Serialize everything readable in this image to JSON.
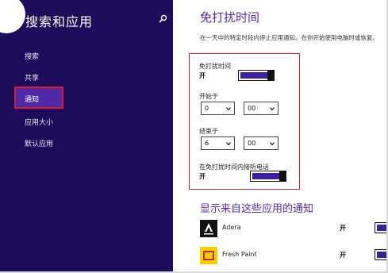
{
  "sidebar": {
    "title": "搜索和应用",
    "items": [
      {
        "label": "搜索"
      },
      {
        "label": "共享"
      },
      {
        "label": "通知",
        "active": true
      },
      {
        "label": "应用大小"
      },
      {
        "label": "默认应用"
      }
    ]
  },
  "quiet_hours": {
    "title": "免打扰时间",
    "description": "在一天中的特定时段内停止应用通知。在你开始使用电脑时或恢复。",
    "toggle_label": "免打扰时间",
    "toggle_state": "开",
    "start_label": "开始于",
    "start_hour": "0",
    "start_minute": "00",
    "end_label": "结束于",
    "end_hour": "6",
    "end_minute": "00",
    "calls_label": "在免打扰时间内接听电话",
    "calls_state": "开"
  },
  "apps": {
    "title": "显示来自这些应用的通知",
    "list": [
      {
        "name": "Adera",
        "state": "开"
      },
      {
        "name": "Fresh Paint",
        "state": "开"
      }
    ]
  },
  "colors": {
    "sidebar_bg": "#1d0b5c",
    "accent": "#5a26b0",
    "toggle_on": "#3d1fa3",
    "highlight_border": "#d41e36"
  }
}
